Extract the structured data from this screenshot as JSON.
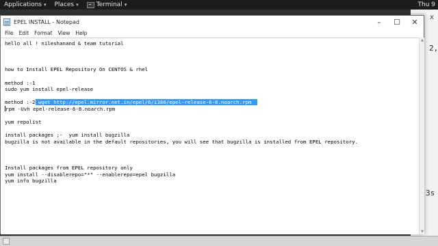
{
  "topbar": {
    "applications": "Applications",
    "places": "Places",
    "terminal": "Terminal",
    "clock": "Thu 9"
  },
  "background_terminal": {
    "title": "x",
    "text_top": "2,",
    "text_bottom": "3s"
  },
  "window": {
    "title": "EPEL INSTALL - Notepad",
    "menu": [
      "File",
      "Edit",
      "Format",
      "View",
      "Help"
    ]
  },
  "editor": {
    "lines": [
      "hello all ! nileshanand & team tutorial",
      "",
      "",
      "",
      "how to Install EPEL Repository On CENTOS & rhel",
      "",
      "method :-1",
      "sudo yum install epel-release",
      "",
      "method :-2",
      "rpm -Uvh epel-release-6-8.noarch.rpm",
      "",
      "yum repolist",
      "",
      "install packages ;-  yum install bugzilla",
      "bugzilla is not available in the default repositories, you will see that bugzilla is installed from EPEL repository.",
      "",
      "",
      "",
      "Install packages from EPEL repository only",
      "yum install --disablerepo=\"*\" --enablerepo=epel bugzilla",
      "yum info bugzilla"
    ],
    "selected_text": " wget http://epel.mirror.net.in/epel/6/i386/epel-release-6-8.noarch.rpm  "
  }
}
